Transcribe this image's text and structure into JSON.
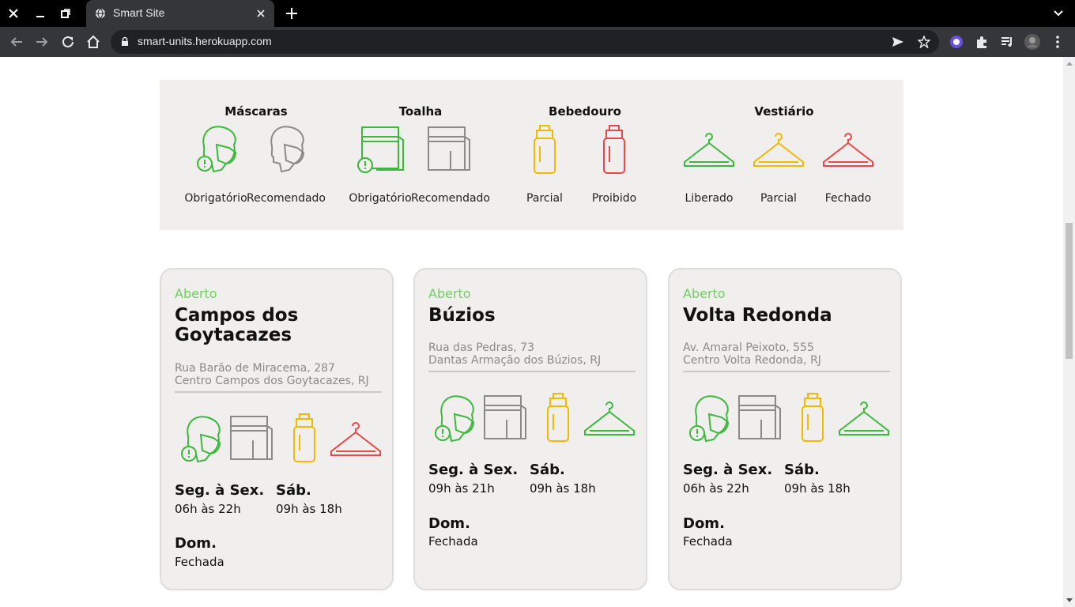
{
  "browser": {
    "tab_title": "Smart Site",
    "url": "smart-units.herokuapp.com"
  },
  "legend": {
    "categories": [
      {
        "title": "Máscaras",
        "labels": [
          "Obrigatório",
          "Recomendado"
        ]
      },
      {
        "title": "Toalha",
        "labels": [
          "Obrigatório",
          "Recomendado"
        ]
      },
      {
        "title": "Bebedouro",
        "labels": [
          "Parcial",
          "Proibido"
        ]
      },
      {
        "title": "Vestiário",
        "labels": [
          "Liberado",
          "Parcial",
          "Fechado"
        ]
      }
    ]
  },
  "colors": {
    "green": "#3cb83c",
    "yellow": "#f5b800",
    "red": "#e84848",
    "gray": "#8a8a8a",
    "open": "#6fcf5f"
  },
  "units": [
    {
      "status": "Aberto",
      "city": "Campos dos Goytacazes",
      "address_line1": "Rua Barão de Miracema, 287",
      "address_line2": "Centro Campos dos Goytacazes, RJ",
      "weekdays_label": "Seg. à Sex.",
      "weekdays_hours": "06h às 22h",
      "saturday_label": "Sáb.",
      "saturday_hours": "09h às 18h",
      "sunday_label": "Dom.",
      "sunday_hours": "Fechada",
      "icons": [
        "mask-required-icon",
        "towel-recommended-icon",
        "bottle-partial-icon",
        "hanger-closed-icon"
      ]
    },
    {
      "status": "Aberto",
      "city": "Búzios",
      "address_line1": "Rua das Pedras, 73",
      "address_line2": "Dantas Armação dos Búzios, RJ",
      "weekdays_label": "Seg. à Sex.",
      "weekdays_hours": "09h às 21h",
      "saturday_label": "Sáb.",
      "saturday_hours": "09h às 18h",
      "sunday_label": "Dom.",
      "sunday_hours": "Fechada",
      "icons": [
        "mask-required-icon",
        "towel-recommended-icon",
        "bottle-partial-icon",
        "hanger-open-icon"
      ]
    },
    {
      "status": "Aberto",
      "city": "Volta Redonda",
      "address_line1": "Av. Amaral Peixoto, 555",
      "address_line2": "Centro Volta Redonda, RJ",
      "weekdays_label": "Seg. à Sex.",
      "weekdays_hours": "06h às 22h",
      "saturday_label": "Sáb.",
      "saturday_hours": "09h às 18h",
      "sunday_label": "Dom.",
      "sunday_hours": "Fechada",
      "icons": [
        "mask-required-icon",
        "towel-recommended-icon",
        "bottle-partial-icon",
        "hanger-open-icon"
      ]
    }
  ]
}
